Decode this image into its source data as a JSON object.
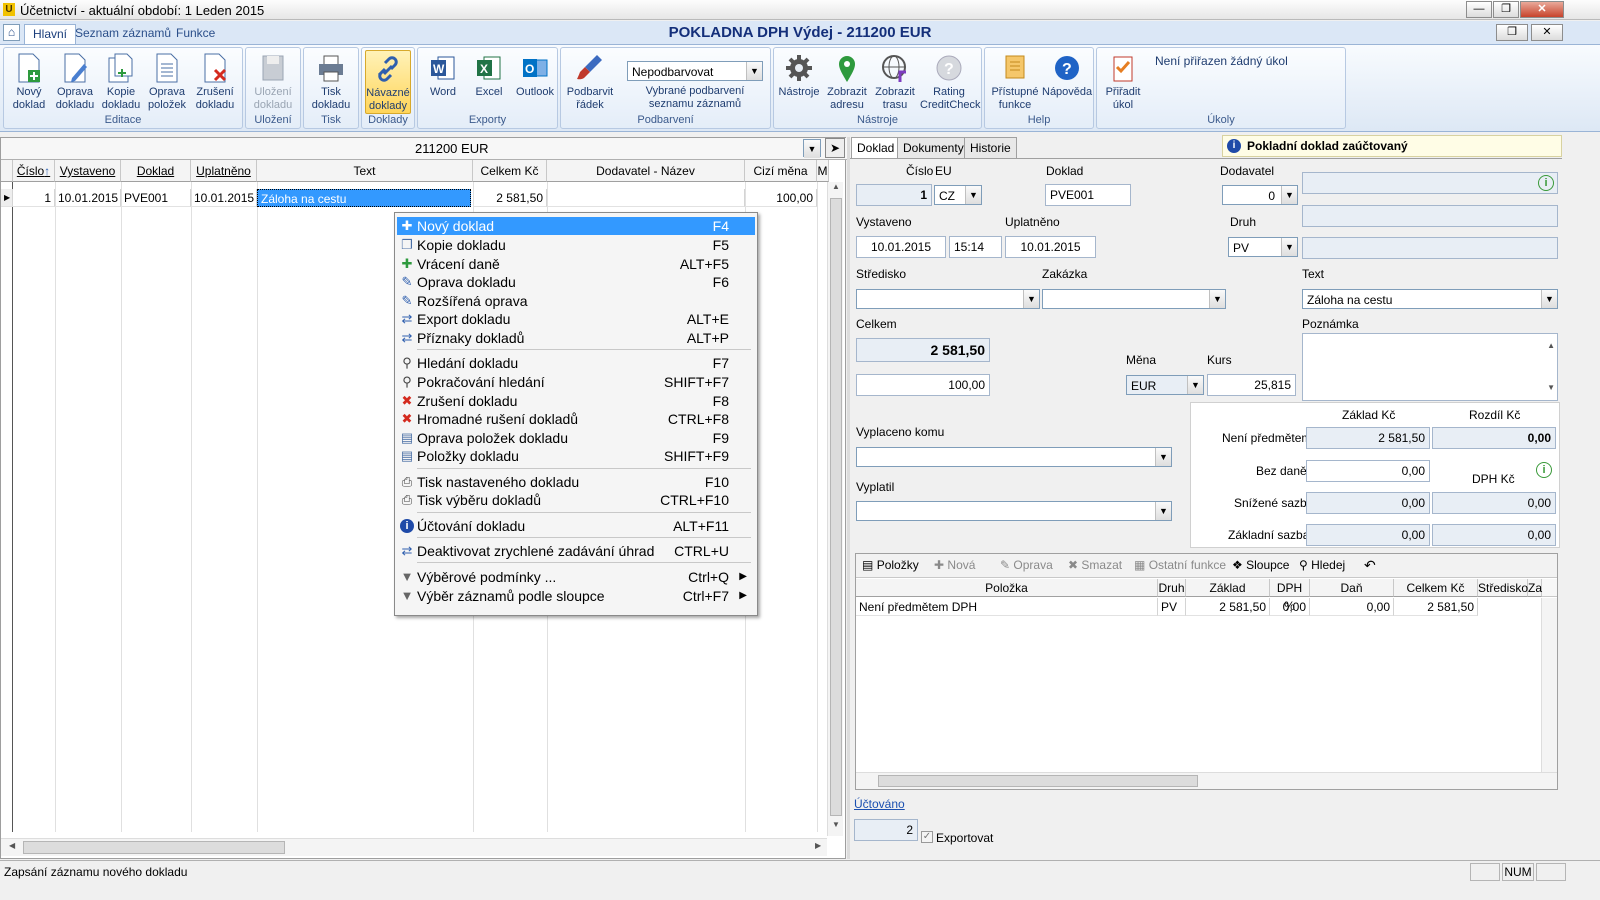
{
  "window": {
    "title": "Účetnictví - aktuální období: 1 Leden 2015",
    "app_icon": "U"
  },
  "ribbon_tabs": [
    "Hlavní",
    "Seznam záznamů",
    "Funkce"
  ],
  "document_title": "POKLADNA DPH Výdej - 211200   EUR",
  "ribbon": {
    "groups": [
      {
        "caption": "Editace",
        "buttons": [
          "Nový doklad",
          "Oprava dokladu",
          "Kopie dokladu",
          "Oprava položek",
          "Zrušení dokladu"
        ]
      },
      {
        "caption": "Uložení",
        "buttons": [
          "Uložení dokladu"
        ]
      },
      {
        "caption": "Tisk",
        "buttons": [
          "Tisk dokladu"
        ]
      },
      {
        "caption": "Doklady",
        "buttons": [
          "Návazné doklady"
        ]
      },
      {
        "caption": "Exporty",
        "buttons": [
          "Word",
          "Excel",
          "Outlook"
        ]
      },
      {
        "caption": "Podbarvení",
        "buttons": [
          "Podbarvit řádek"
        ]
      },
      {
        "caption": "Nástroje",
        "buttons": [
          "Nástroje",
          "Zobrazit adresu",
          "Zobrazit trasu",
          "Rating CreditCheck"
        ]
      },
      {
        "caption": "Help",
        "buttons": [
          "Přístupné funkce",
          "Nápověda"
        ]
      },
      {
        "caption": "Úkoly",
        "buttons": [
          "Přiřadit úkol"
        ]
      }
    ],
    "color_select_value": "Nepodbarvovat",
    "color_select_note": "Vybrané podbarvení seznamu záznamů",
    "tasks_note": "Není přiřazen žádný úkol"
  },
  "grid": {
    "filter_value": "211200   EUR",
    "columns": [
      "Číslo",
      "Vystaveno",
      "Doklad",
      "Uplatněno",
      "Text",
      "Celkem Kč",
      "Dodavatel - Název",
      "Cizí měna",
      "M"
    ],
    "rows": [
      {
        "cislo": "1",
        "vystaveno": "10.01.2015",
        "doklad": "PVE001",
        "uplatneno": "10.01.2015",
        "text": "Záloha na cestu",
        "celkem": "2 581,50",
        "dodavatel": "",
        "cizi": "100,00"
      }
    ]
  },
  "context_menu": [
    {
      "label": "Nový doklad",
      "shortcut": "F4",
      "icon": "plus-icon"
    },
    {
      "label": "Kopie dokladu",
      "shortcut": "F5",
      "icon": "copy-icon"
    },
    {
      "label": "Vrácení daně",
      "shortcut": "ALT+F5",
      "icon": "plus-icon"
    },
    {
      "label": "Oprava dokladu",
      "shortcut": "F6",
      "icon": "pencil-icon"
    },
    {
      "label": "Rozšířená oprava",
      "shortcut": "",
      "icon": "pencil-icon"
    },
    {
      "label": "Export dokladu",
      "shortcut": "ALT+E",
      "icon": "exchange-icon"
    },
    {
      "label": "Příznaky dokladů",
      "shortcut": "ALT+P",
      "icon": "exchange-icon"
    },
    {
      "label": "Hledání dokladu",
      "shortcut": "F7",
      "icon": "magnifier-icon"
    },
    {
      "label": "Pokračování hledání",
      "shortcut": "SHIFT+F7",
      "icon": "magnifier-icon"
    },
    {
      "label": "Zrušení dokladu",
      "shortcut": "F8",
      "icon": "x-icon"
    },
    {
      "label": "Hromadné rušení dokladů",
      "shortcut": "CTRL+F8",
      "icon": "x-icon"
    },
    {
      "label": "Oprava položek dokladu",
      "shortcut": "F9",
      "icon": "list-icon"
    },
    {
      "label": "Položky dokladu",
      "shortcut": "SHIFT+F9",
      "icon": "list-icon"
    },
    {
      "label": "Tisk nastaveného dokladu",
      "shortcut": "F10",
      "icon": "printer-icon"
    },
    {
      "label": "Tisk výběru dokladů",
      "shortcut": "CTRL+F10",
      "icon": "printer-icon"
    },
    {
      "label": "Účtování dokladu",
      "shortcut": "ALT+F11",
      "icon": "info-icon"
    },
    {
      "label": "Deaktivovat  zrychlené zadávání úhrad",
      "shortcut": "CTRL+U",
      "icon": "exchange-icon"
    },
    {
      "label": "Výběrové podmínky ...",
      "shortcut": "Ctrl+Q",
      "icon": "funnel-icon"
    },
    {
      "label": "Výběr záznamů podle sloupce",
      "shortcut": "Ctrl+F7",
      "icon": "funnel-icon"
    }
  ],
  "detail": {
    "tabs": [
      "Doklad",
      "Dokumenty",
      "Historie"
    ],
    "status": "Pokladní doklad  zaúčtovaný",
    "labels": {
      "cislo": "Číslo",
      "eu": "EU",
      "doklad": "Doklad",
      "dodavatel": "Dodavatel",
      "vystaveno": "Vystaveno",
      "uplatneno": "Uplatněno",
      "druh": "Druh",
      "stredisko": "Středisko",
      "zakazka": "Zakázka",
      "text": "Text",
      "celkem": "Celkem",
      "poznamka": "Poznámka",
      "mena": "Měna",
      "kurs": "Kurs",
      "vyplaceno": "Vyplaceno komu",
      "vyplatil": "Vyplatil",
      "zaklad": "Základ Kč",
      "rozdil": "Rozdíl Kč",
      "dph": "DPH Kč",
      "neni": "Není předmětem",
      "bez": "Bez daně",
      "snizene": "Snížené sazby",
      "zakladni": "Základní sazba"
    },
    "values": {
      "cislo": "1",
      "eu": "CZ",
      "doklad": "PVE001",
      "dodavatel": "0",
      "vystaveno_date": "10.01.2015",
      "vystaveno_time": "15:14",
      "uplatneno": "10.01.2015",
      "druh": "PV",
      "text": "Záloha na cestu",
      "celkem": "2 581,50",
      "cizi": "100,00",
      "mena": "EUR",
      "kurs": "25,815",
      "neni_zaklad": "2 581,50",
      "neni_rozdil": "0,00",
      "bez_zaklad": "0,00",
      "snizene_zaklad": "0,00",
      "snizene_dph": "0,00",
      "zakladni_zaklad": "0,00",
      "zakladni_dph": "0,00"
    },
    "items_toolbar": [
      "Položky",
      "Nová",
      "Oprava",
      "Smazat",
      "Ostatní funkce",
      "Sloupce",
      "Hledej"
    ],
    "items_columns": [
      "Položka",
      "Druh",
      "Základ",
      "DPH %",
      "Daň",
      "Celkem Kč",
      "Středisko",
      "Za"
    ],
    "items_rows": [
      {
        "polozka": "Není předmětem DPH",
        "druh": "PV",
        "zaklad": "2 581,50",
        "dph": "0,00",
        "dan": "0,00",
        "celkem": "2 581,50"
      }
    ],
    "uctovano_link": "Účtováno",
    "uctovano_value": "2",
    "exportovat": "Exportovat"
  },
  "statusbar": {
    "message": "Zapsání záznamu nového dokladu",
    "num": "NUM"
  }
}
